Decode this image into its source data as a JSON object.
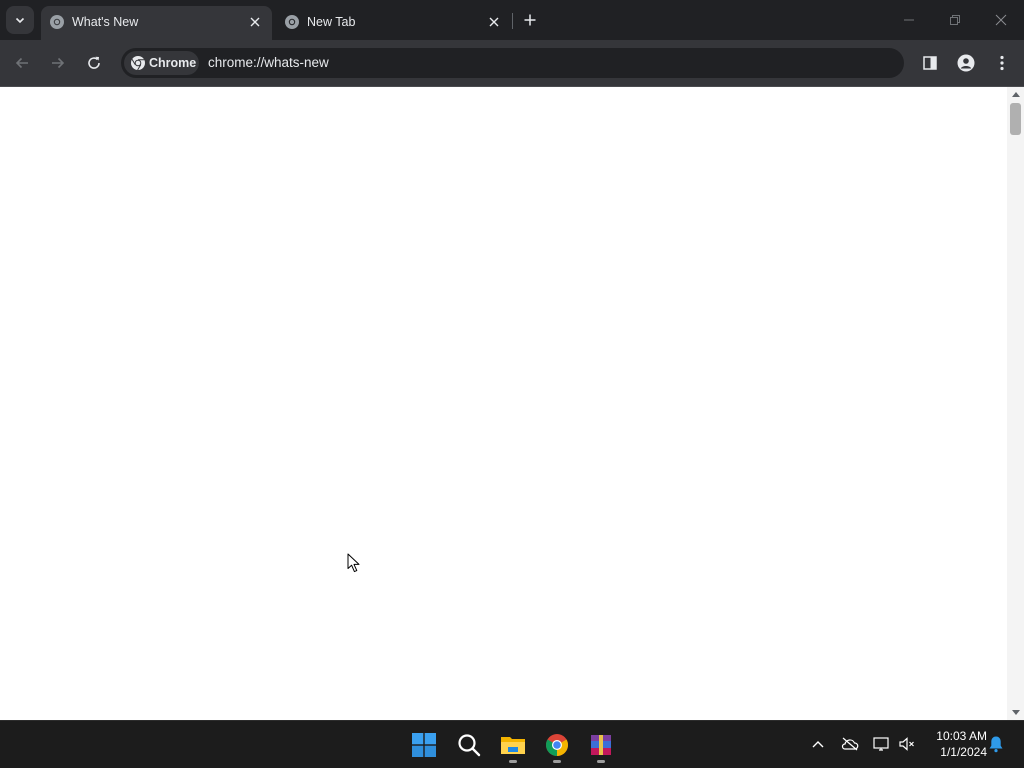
{
  "browser": {
    "tabs": [
      {
        "title": "What's New",
        "active": true
      },
      {
        "title": "New Tab",
        "active": false
      }
    ],
    "omnibox": {
      "chip_label": "Chrome",
      "url": "chrome://whats-new"
    }
  },
  "icons": {
    "tab_search": "chevron-down-icon",
    "favicon": "chrome-favicon-icon",
    "close": "close-icon",
    "new_tab": "plus-icon",
    "minimize": "minimize-icon",
    "maximize": "restore-icon",
    "window_close": "close-icon",
    "back": "arrow-left-icon",
    "forward": "arrow-right-icon",
    "reload": "reload-icon",
    "bookmark": "star-icon",
    "side_panel": "side-panel-icon",
    "profile": "profile-icon",
    "menu": "kebab-menu-icon"
  },
  "taskbar": {
    "apps": [
      "start",
      "search",
      "file-explorer",
      "chrome",
      "winrar"
    ],
    "clock": {
      "time": "10:03 AM",
      "date": "1/1/2024"
    }
  },
  "colors": {
    "tabstrip": "#202124",
    "toolbar": "#35363a",
    "omnibox": "#202124",
    "taskbar": "#1c1c1c",
    "windows_blue": "#2f9bea"
  }
}
